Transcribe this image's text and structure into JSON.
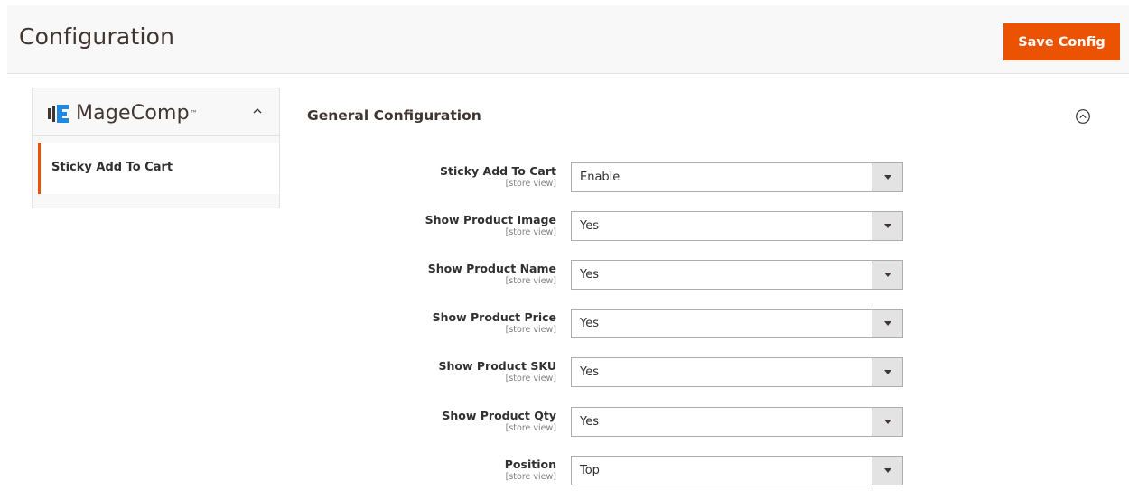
{
  "header": {
    "title": "Configuration",
    "save_label": "Save Config"
  },
  "sidebar": {
    "logo_text": "MageComp",
    "logo_tm": "™",
    "items": [
      {
        "label": "Sticky Add To Cart",
        "active": true
      }
    ]
  },
  "section": {
    "title": "General Configuration"
  },
  "fields": [
    {
      "label": "Sticky Add To Cart",
      "scope": "[store view]",
      "value": "Enable"
    },
    {
      "label": "Show Product Image",
      "scope": "[store view]",
      "value": "Yes"
    },
    {
      "label": "Show Product Name",
      "scope": "[store view]",
      "value": "Yes"
    },
    {
      "label": "Show Product Price",
      "scope": "[store view]",
      "value": "Yes"
    },
    {
      "label": "Show Product SKU",
      "scope": "[store view]",
      "value": "Yes"
    },
    {
      "label": "Show Product Qty",
      "scope": "[store view]",
      "value": "Yes"
    },
    {
      "label": "Position",
      "scope": "[store view]",
      "value": "Top"
    }
  ],
  "colors": {
    "accent": "#eb5202",
    "logo_blue": "#1e88e5"
  },
  "icons": {
    "sidebar_toggle": "chevron-up-icon",
    "section_toggle": "collapse-circle-icon",
    "select_arrow": "caret-down-icon"
  }
}
